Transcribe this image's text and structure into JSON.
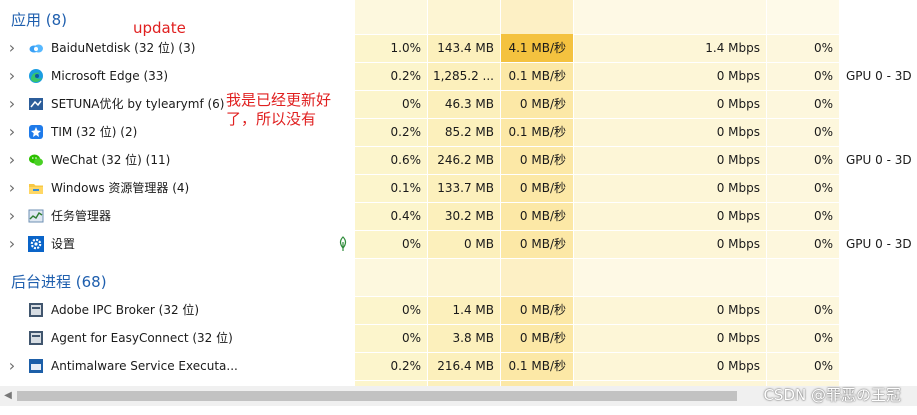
{
  "colors": {
    "cpu_col": "#fcf5cc",
    "mem_col": "#fcf0bc",
    "disk_col": "#fce8a6",
    "disk_high": "#f4c23f",
    "net_col": "#fdf6d7",
    "gpu_col": "#fdf7dd",
    "group_title": "#1f5fae",
    "annotation": "#e02020"
  },
  "apps_group": {
    "title": "应用 (8)"
  },
  "background_group": {
    "title": "后台进程 (68)"
  },
  "apps": [
    {
      "icon": "baidu-netdisk-icon",
      "name": "BaiduNetdisk (32 位) (3)",
      "cpu": "1.0%",
      "mem": "143.4 MB",
      "disk": "4.1 MB/秒",
      "net": "1.4 Mbps",
      "gpu": "0%",
      "gpu_engine": "",
      "expandable": true,
      "disk_high": true
    },
    {
      "icon": "edge-icon",
      "name": "Microsoft Edge (33)",
      "cpu": "0.2%",
      "mem": "1,285.2 ...",
      "disk": "0.1 MB/秒",
      "net": "0 Mbps",
      "gpu": "0%",
      "gpu_engine": "GPU 0 - 3D",
      "expandable": true
    },
    {
      "icon": "setuna-icon",
      "name": "SETUNA优化 by tylearymf (6)",
      "cpu": "0%",
      "mem": "46.3 MB",
      "disk": "0 MB/秒",
      "net": "0 Mbps",
      "gpu": "0%",
      "gpu_engine": "",
      "expandable": true
    },
    {
      "icon": "tim-icon",
      "name": "TIM (32 位) (2)",
      "cpu": "0.2%",
      "mem": "85.2 MB",
      "disk": "0.1 MB/秒",
      "net": "0 Mbps",
      "gpu": "0%",
      "gpu_engine": "",
      "expandable": true
    },
    {
      "icon": "wechat-icon",
      "name": "WeChat (32 位) (11)",
      "cpu": "0.6%",
      "mem": "246.2 MB",
      "disk": "0 MB/秒",
      "net": "0 Mbps",
      "gpu": "0%",
      "gpu_engine": "GPU 0 - 3D",
      "expandable": true
    },
    {
      "icon": "file-explorer-icon",
      "name": "Windows 资源管理器 (4)",
      "cpu": "0.1%",
      "mem": "133.7 MB",
      "disk": "0 MB/秒",
      "net": "0 Mbps",
      "gpu": "0%",
      "gpu_engine": "",
      "expandable": true
    },
    {
      "icon": "task-manager-icon",
      "name": "任务管理器",
      "cpu": "0.4%",
      "mem": "30.2 MB",
      "disk": "0 MB/秒",
      "net": "0 Mbps",
      "gpu": "0%",
      "gpu_engine": "",
      "expandable": true
    },
    {
      "icon": "settings-gear-icon",
      "name": "设置",
      "cpu": "0%",
      "mem": "0 MB",
      "disk": "0 MB/秒",
      "net": "0 Mbps",
      "gpu": "0%",
      "gpu_engine": "GPU 0 - 3D",
      "expandable": true,
      "suspended_leaf": true
    }
  ],
  "background": [
    {
      "icon": "adobe-ipc-icon",
      "name": "Adobe IPC Broker (32 位)",
      "cpu": "0%",
      "mem": "1.4 MB",
      "disk": "0 MB/秒",
      "net": "0 Mbps",
      "gpu": "0%",
      "gpu_engine": "",
      "expandable": false
    },
    {
      "icon": "easyconnect-icon",
      "name": "Agent for EasyConnect (32 位)",
      "cpu": "0%",
      "mem": "3.8 MB",
      "disk": "0 MB/秒",
      "net": "0 Mbps",
      "gpu": "0%",
      "gpu_engine": "",
      "expandable": false
    },
    {
      "icon": "antimalware-icon",
      "name": "Antimalware Service Executa...",
      "cpu": "0.2%",
      "mem": "216.4 MB",
      "disk": "0.1 MB/秒",
      "net": "0 Mbps",
      "gpu": "0%",
      "gpu_engine": "",
      "expandable": true
    }
  ],
  "annotations": {
    "update": "update",
    "note_line1": "我是已经更新好",
    "note_line2": "了，所以没有"
  },
  "watermark": "CSDN @罪恶の王冠"
}
